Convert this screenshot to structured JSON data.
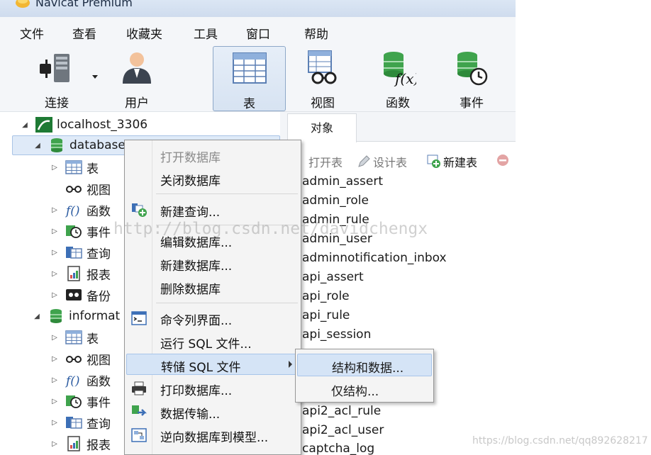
{
  "window": {
    "title": "Navicat Premium"
  },
  "menubar": [
    "文件",
    "查看",
    "收藏夹",
    "工具",
    "窗口",
    "帮助"
  ],
  "toolbar": {
    "tools": [
      {
        "label": "连接",
        "icon": "connect-plug-icon"
      },
      {
        "label": "用户",
        "icon": "user-icon"
      },
      {
        "label": "表",
        "icon": "table-icon",
        "active": true
      },
      {
        "label": "视图",
        "icon": "view-icon"
      },
      {
        "label": "函数",
        "icon": "function-icon"
      },
      {
        "label": "事件",
        "icon": "event-icon"
      }
    ]
  },
  "navigator": {
    "connection": "localhost_3306",
    "databases": [
      {
        "name": "database",
        "children": [
          "表",
          "视图",
          "函数",
          "事件",
          "查询",
          "报表",
          "备份"
        ]
      },
      {
        "name": "informat",
        "children": [
          "表",
          "视图",
          "函数",
          "事件",
          "查询",
          "报表"
        ]
      }
    ]
  },
  "object_panel": {
    "tab": "对象",
    "buttons": {
      "open": "打开表",
      "design": "设计表",
      "new": "新建表"
    },
    "tables": [
      "admin_assert",
      "admin_role",
      "admin_rule",
      "admin_user",
      "adminnotification_inbox",
      "api_assert",
      "api_role",
      "api_rule",
      "api_session",
      "api2_acl_rule",
      "api2_acl_user",
      "captcha_log"
    ]
  },
  "context_menu": {
    "items": [
      {
        "label": "打开数据库",
        "disabled": true
      },
      {
        "label": "关闭数据库"
      },
      {
        "label": "新建查询...",
        "icon": "new-query-icon"
      },
      {
        "label": "编辑数据库..."
      },
      {
        "label": "新建数据库..."
      },
      {
        "label": "删除数据库"
      },
      {
        "label": "命令列界面...",
        "icon": "console-icon"
      },
      {
        "label": "运行 SQL 文件..."
      },
      {
        "label": "转储 SQL 文件",
        "highlight": true,
        "submenu": true
      },
      {
        "label": "打印数据库...",
        "icon": "printer-icon"
      },
      {
        "label": "数据传输...",
        "icon": "data-transfer-icon"
      },
      {
        "label": "逆向数据库到模型...",
        "icon": "reverse-model-icon"
      }
    ]
  },
  "submenu": {
    "items": [
      {
        "label": "结构和数据...",
        "highlight": true
      },
      {
        "label": "仅结构..."
      }
    ]
  },
  "watermark": "http://blog.csdn.net/davidchengx",
  "footer_watermark": "https://blog.csdn.net/qq892628217",
  "colors": {
    "selection": "#dfeaf8",
    "menu_highlight": "#d5e4f6",
    "db_green": "#3fa34d"
  }
}
